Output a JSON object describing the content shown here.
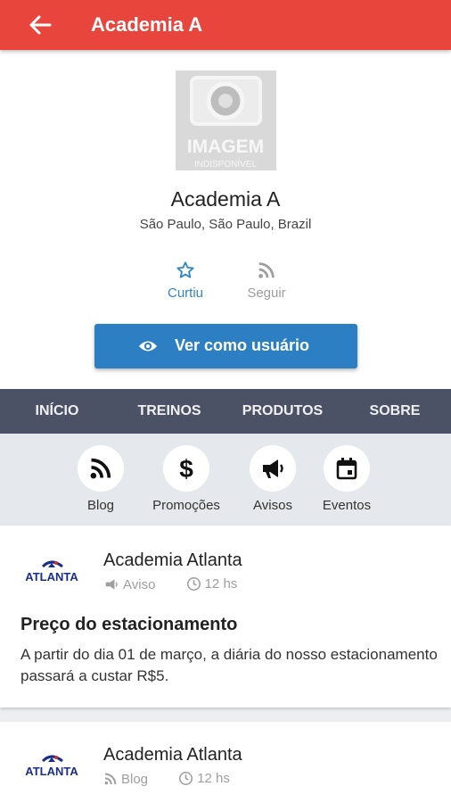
{
  "appbar": {
    "title": "Academia A",
    "back_icon": "arrow-left-icon"
  },
  "profile": {
    "image_text_main": "IMAGEM",
    "image_text_sub": "INDISPONÍVEL",
    "name": "Academia A",
    "location": "São Paulo, São Paulo, Brazil",
    "liked_label": "Curtiu",
    "follow_label": "Seguir",
    "view_as_user_label": "Ver como usuário"
  },
  "tabs": [
    "INÍCIO",
    "TREINOS",
    "PRODUTOS",
    "SOBRE"
  ],
  "categories": [
    {
      "label": "Blog",
      "icon": "rss-icon"
    },
    {
      "label": "Promoções",
      "icon": "dollar-icon"
    },
    {
      "label": "Avisos",
      "icon": "megaphone-icon"
    },
    {
      "label": "Eventos",
      "icon": "calendar-icon"
    }
  ],
  "posts": [
    {
      "logo_text": "ATLANTA",
      "author": "Academia Atlanta",
      "type": "Aviso",
      "time": "12 hs",
      "title": "Preço do estacionamento",
      "body": "A partir do dia 01 de março, a diária do nosso estacionamento passará a custar R$5."
    },
    {
      "logo_text": "ATLANTA",
      "author": "Academia Atlanta",
      "type": "Blog",
      "time": "12 hs"
    }
  ],
  "colors": {
    "appbar": "#e8453c",
    "accent": "#2d7fc4",
    "tabs": "#4b5266",
    "liked": "#2e86c9"
  }
}
